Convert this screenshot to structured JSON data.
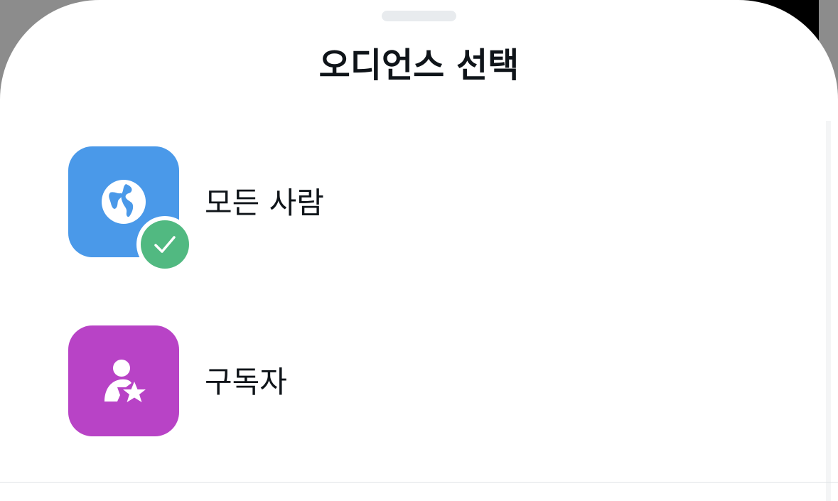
{
  "sheet": {
    "title": "오디언스 선택"
  },
  "options": [
    {
      "label": "모든 사람",
      "icon": "globe-icon",
      "color": "#4a99e9",
      "selected": true
    },
    {
      "label": "구독자",
      "icon": "subscriber-star-icon",
      "color": "#b843c6",
      "selected": false
    }
  ],
  "colors": {
    "selected_check": "#51b981",
    "text": "#0f1419"
  }
}
